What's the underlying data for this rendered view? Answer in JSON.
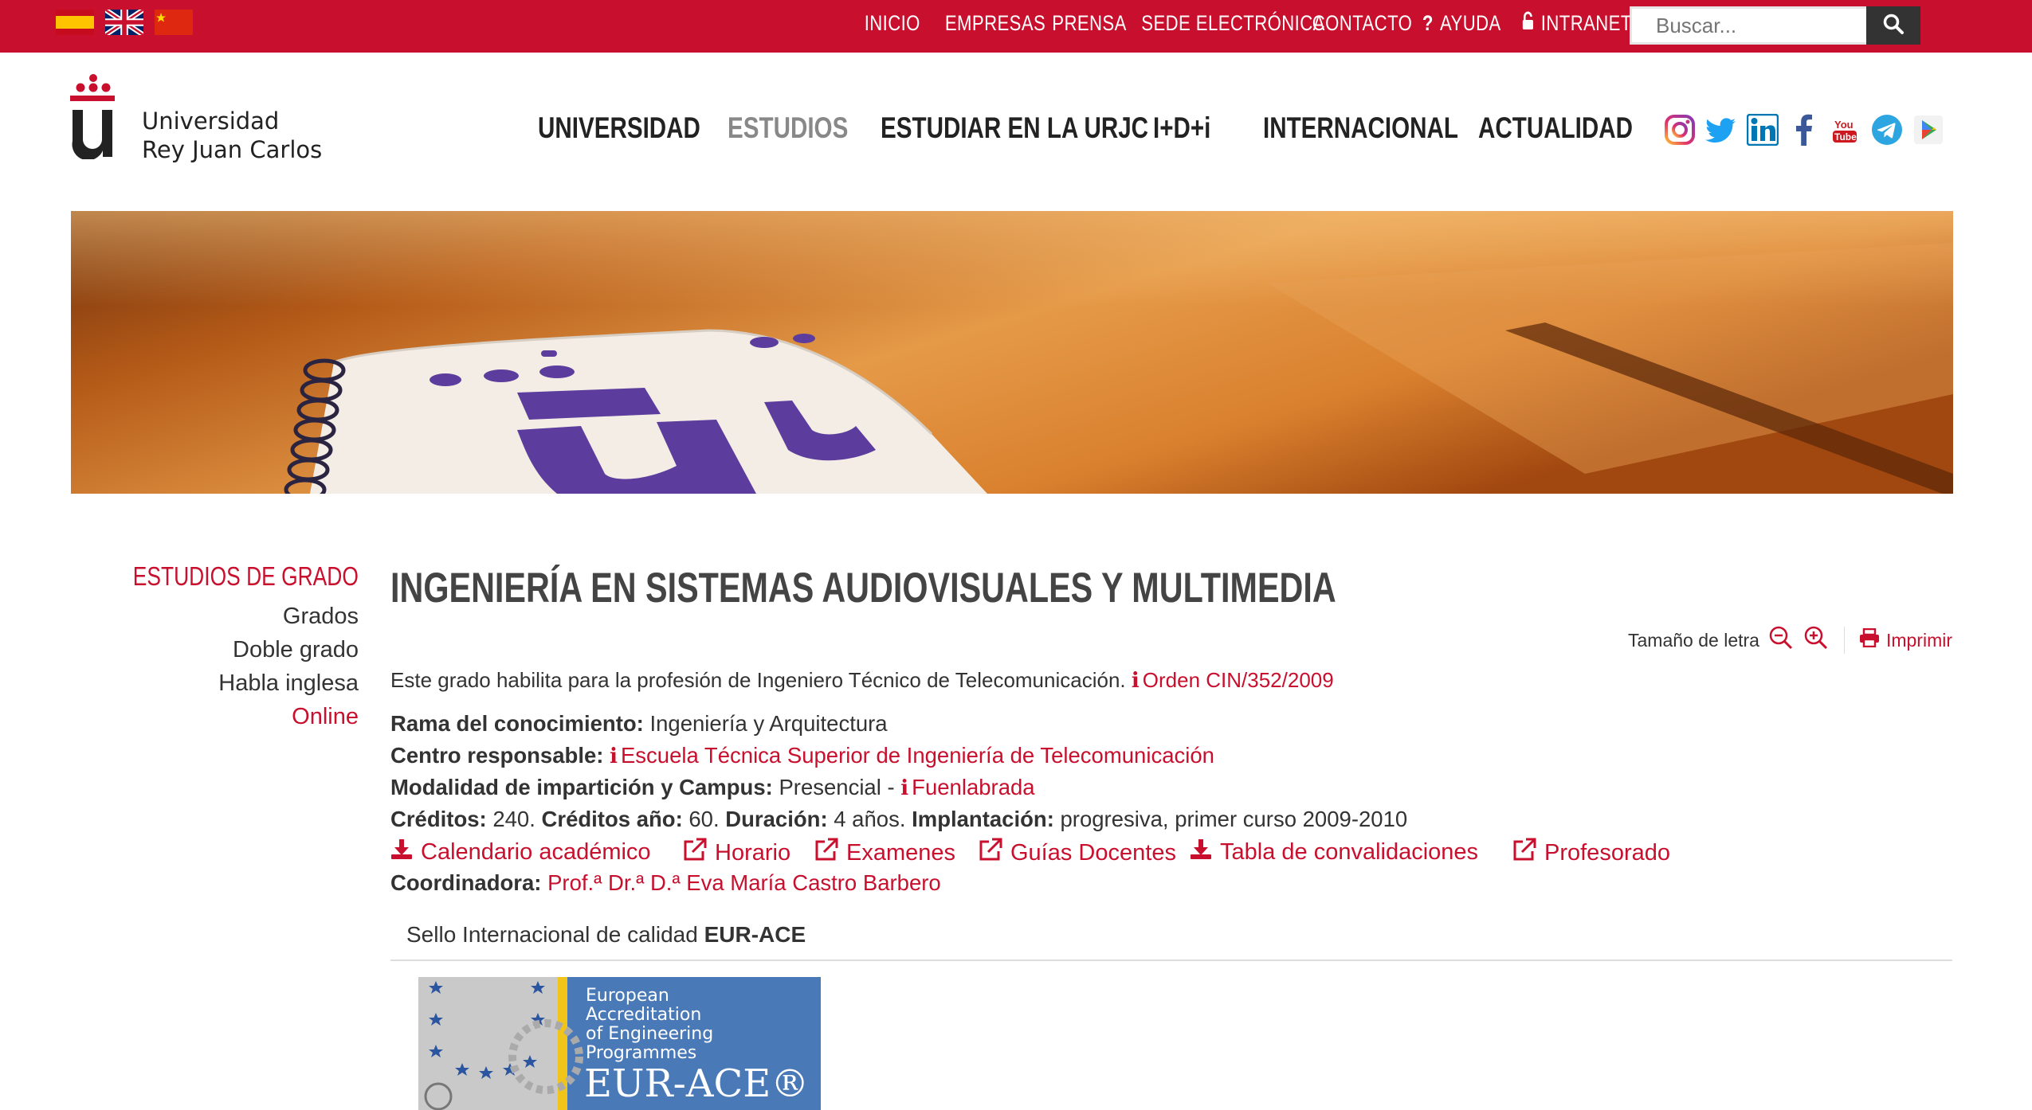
{
  "topbar": {
    "languages": [
      "es-flag",
      "uk-flag",
      "cn-flag"
    ],
    "nav": [
      "INICIO",
      "EMPRESAS",
      "PRENSA",
      "SEDE ELECTRÓNICA",
      "CONTACTO",
      "AYUDA",
      "INTRANET"
    ],
    "search_placeholder": "Buscar...",
    "brand_color": "#c8102e"
  },
  "logo": {
    "line1": "Universidad",
    "line2": "Rey Juan Carlos"
  },
  "mainnav": {
    "items": [
      "UNIVERSIDAD",
      "ESTUDIOS",
      "ESTUDIAR EN LA URJC",
      "I+D+i",
      "INTERNACIONAL",
      "ACTUALIDAD"
    ],
    "active": "ESTUDIOS"
  },
  "social": [
    "instagram-icon",
    "twitter-icon",
    "linkedin-icon",
    "facebook-icon",
    "youtube-icon",
    "telegram-icon",
    "play-icon"
  ],
  "sidebar": {
    "title": "ESTUDIOS DE GRADO",
    "items": [
      "Grados",
      "Doble grado",
      "Habla inglesa",
      "Online"
    ]
  },
  "main": {
    "title": "INGENIERÍA EN SISTEMAS AUDIOVISUALES Y MULTIMEDIA",
    "font_size_label": "Tamaño de letra",
    "print_label": "Imprimir",
    "intro": "Este grado habilita para la profesión de Ingeniero Técnico de Telecomunicación.",
    "intro_link": "Orden CIN/352/2009",
    "rama_label": "Rama del conocimiento:",
    "rama_value": "Ingeniería y Arquitectura",
    "centro_label": "Centro responsable:",
    "centro_value": "Escuela Técnica Superior de Ingeniería de Telecomunicación",
    "modalidad_label": "Modalidad de impartición y Campus:",
    "modalidad_value": "Presencial -",
    "campus_value": "Fuenlabrada",
    "creditos_label": "Créditos:",
    "creditos_value": "240.",
    "creditos_ano_label": "Créditos año:",
    "creditos_ano_value": "60.",
    "duracion_label": "Duración:",
    "duracion_value": "4 años.",
    "implantacion_label": "Implantación:",
    "implantacion_value": "progresiva, primer curso 2009-2010",
    "links": [
      "Calendario académico",
      "Horario",
      "Examenes",
      "Guías Docentes",
      "Tabla de convalidaciones",
      "Profesorado"
    ],
    "coord_label": "Coordinadora:",
    "coord_value": "Prof.ª Dr.ª D.ª Eva María Castro Barbero",
    "seal_prefix": "Sello Internacional de calidad",
    "seal_name": "EUR-ACE",
    "badge": {
      "line1": "European",
      "line2": "Accreditation",
      "line3": "of Engineering",
      "line4": "Programmes",
      "logo": "EUR-ACE®"
    }
  }
}
